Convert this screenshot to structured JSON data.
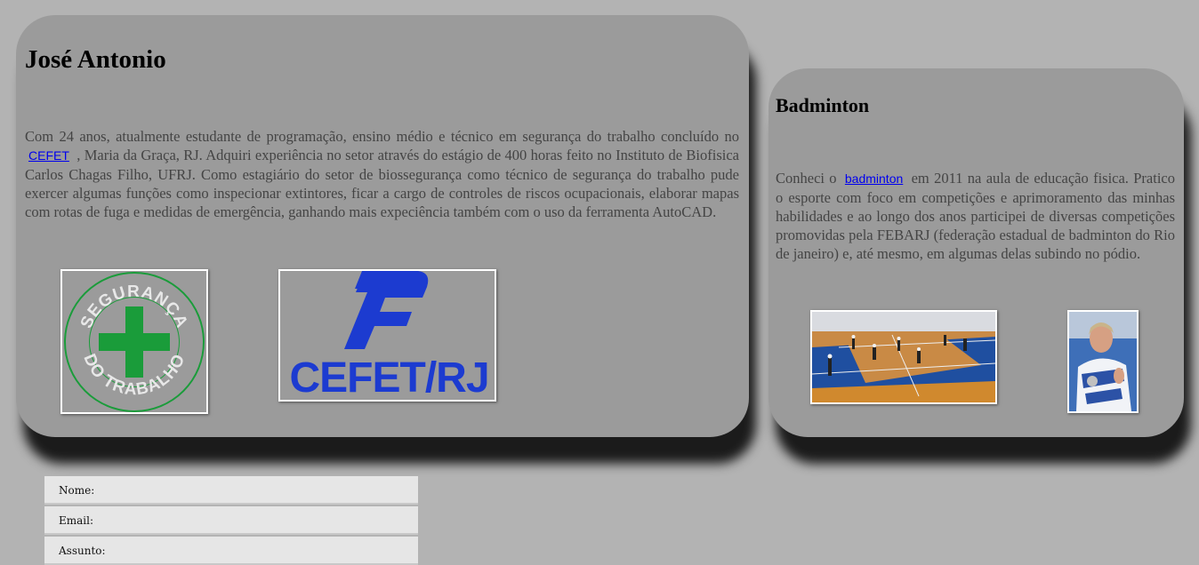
{
  "main": {
    "title": "José Antonio",
    "intro_before": "Com 24 anos, atualmente estudante de programação, ensino médio e técnico em segurança do trabalho concluído no ",
    "link_text": "CEFET",
    "intro_after": " , Maria da Graça, RJ. Adquiri experiência no setor através do estágio de 400 horas feito no Instituto de Biofisica Carlos Chagas Filho, UFRJ. Como estagiário do setor de biossegurança como técnico de segurança do trabalho pude exercer algumas funções como inspecionar extintores, ficar a cargo de controles de riscos ocupacionais, elaborar mapas com rotas de fuga e medidas de emergência, ganhando mais expeciência também com o uso da ferramenta AutoCAD.",
    "seg_logo_top": "SEGURANÇA",
    "seg_logo_bottom": "DO TRABALHO",
    "cefet_logo_text": "CEFET/RJ"
  },
  "side": {
    "title": "Badminton",
    "text_before": "Conheci o ",
    "link_text": "badminton",
    "text_after": " em 2011 na aula de educação fisica. Pratico o esporte com foco em competições e aprimoramento das minhas habilidades e ao longo dos anos participei de diversas competições promovidas pela FEBARJ (federação estadual de badminton do Rio de janeiro) e, até mesmo, em algumas delas subindo no pódio."
  },
  "form": {
    "name_label": "Nome:",
    "email_label": "Email:",
    "subject_label": "Assunto:"
  },
  "colors": {
    "page_bg": "#b3b3b3",
    "card_bg": "#9b9b9b",
    "link": "#0000ee",
    "seg_green": "#1a9c3a",
    "cefet_blue": "#1c3bd0"
  }
}
